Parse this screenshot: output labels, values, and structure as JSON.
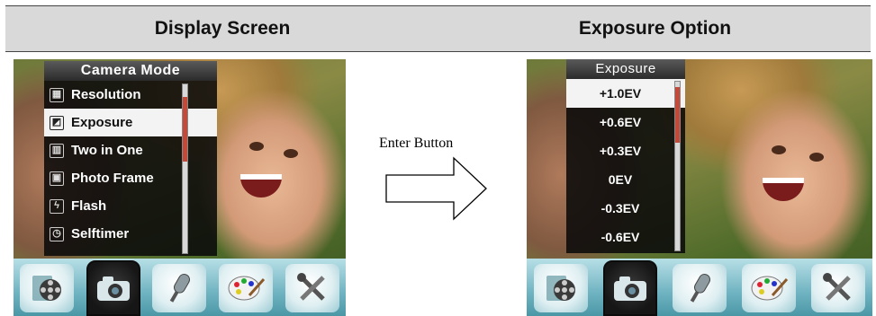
{
  "headers": {
    "left": "Display Screen",
    "right": "Exposure Option"
  },
  "camera_menu": {
    "title": "Camera Mode",
    "items": [
      {
        "label": "Resolution",
        "icon": "resolution-icon",
        "selected": false
      },
      {
        "label": "Exposure",
        "icon": "exposure-icon",
        "selected": true
      },
      {
        "label": "Two in One",
        "icon": "two-in-one-icon",
        "selected": false
      },
      {
        "label": "Photo Frame",
        "icon": "photo-frame-icon",
        "selected": false
      },
      {
        "label": "Flash",
        "icon": "flash-icon",
        "selected": false
      },
      {
        "label": "Selftimer",
        "icon": "selftimer-icon",
        "selected": false
      }
    ]
  },
  "exposure_menu": {
    "title": "Exposure",
    "items": [
      {
        "label": "+1.0EV",
        "selected": true
      },
      {
        "label": "+0.6EV",
        "selected": false
      },
      {
        "label": "+0.3EV",
        "selected": false
      },
      {
        "label": "0EV",
        "selected": false
      },
      {
        "label": "-0.3EV",
        "selected": false
      },
      {
        "label": "-0.6EV",
        "selected": false
      }
    ]
  },
  "toolbar": {
    "items": [
      {
        "icon": "movie-reel-icon",
        "active": false
      },
      {
        "icon": "camera-icon",
        "active": true
      },
      {
        "icon": "microphone-icon",
        "active": false
      },
      {
        "icon": "palette-icon",
        "active": false
      },
      {
        "icon": "tools-icon",
        "active": false
      }
    ]
  },
  "transition": {
    "label": "Enter Button"
  },
  "colors": {
    "header_bg": "#d9d9d9",
    "selection_bg": "#f3f3f3",
    "scroll_thumb": "#c24a3a",
    "toolbar_accent": "#6fb3c1"
  }
}
